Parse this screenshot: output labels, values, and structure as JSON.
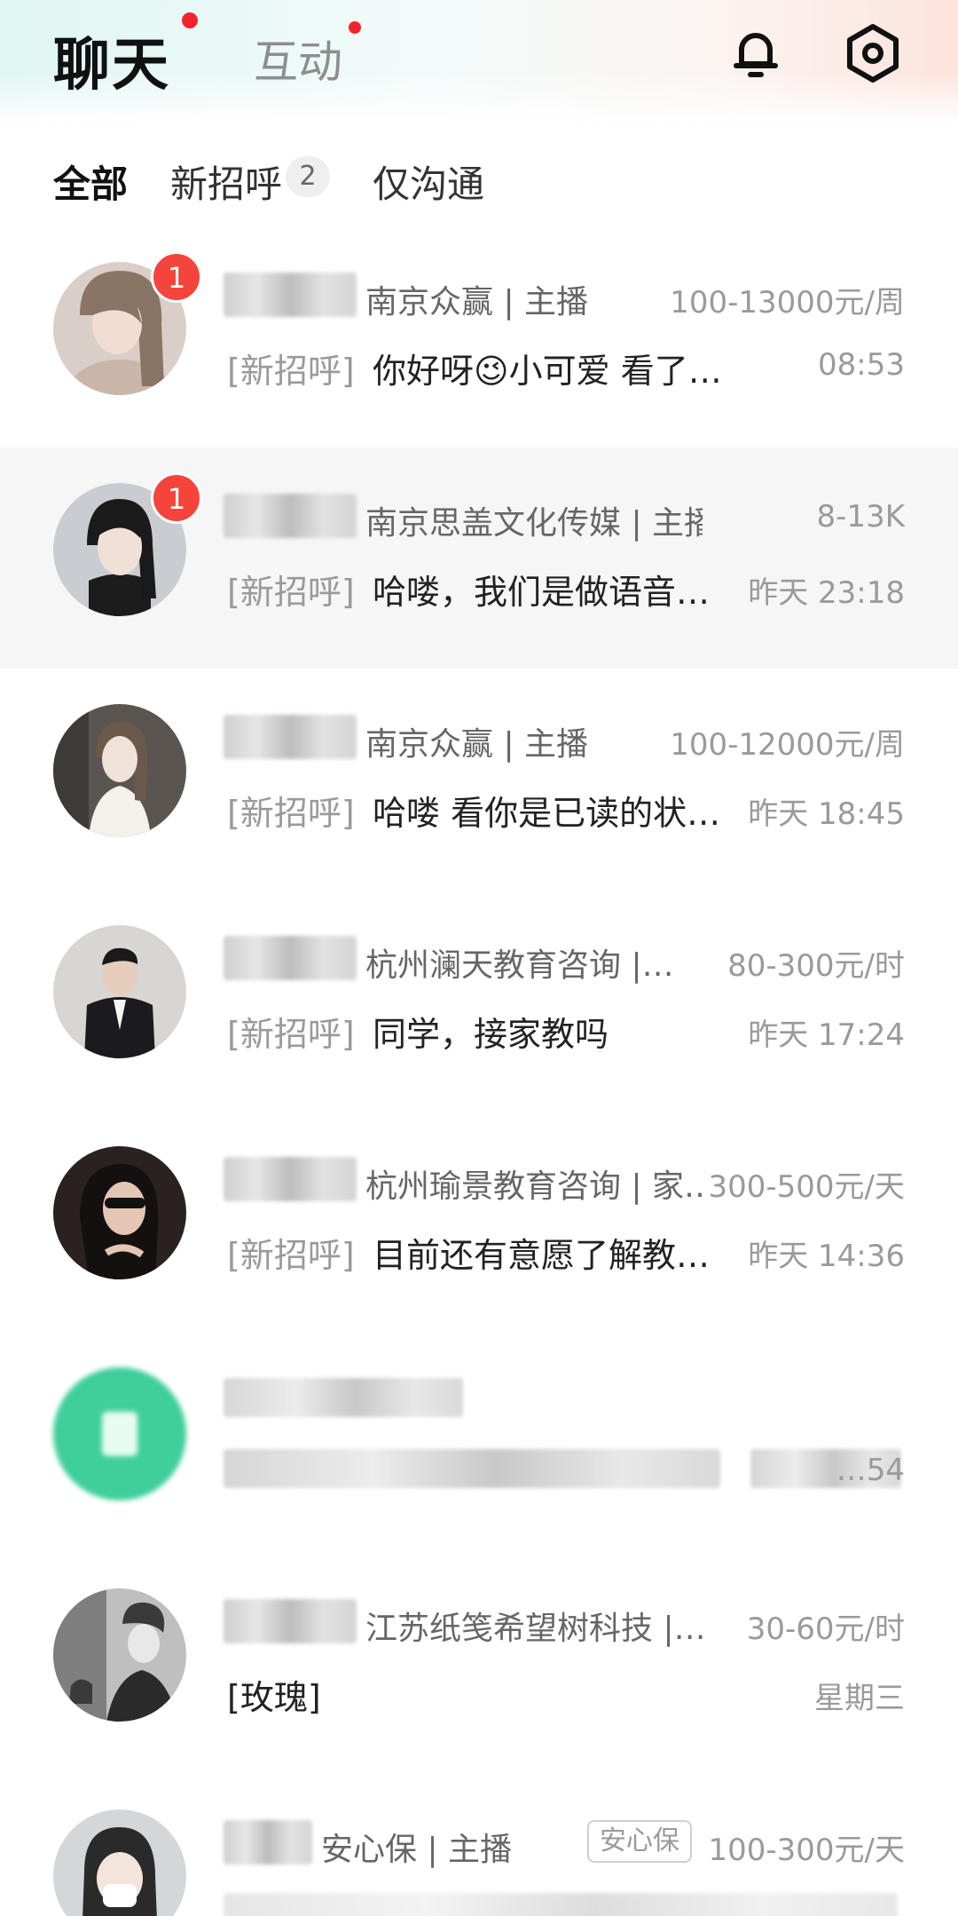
{
  "header": {
    "title": "聊天",
    "alt_tab": "互动",
    "bell_icon": "bell-icon",
    "settings_icon": "gear-icon"
  },
  "tabs": [
    {
      "label": "全部",
      "active": true
    },
    {
      "label": "新招呼",
      "badge": "2"
    },
    {
      "label": "仅沟通"
    }
  ],
  "colors": {
    "accent": "#2fbfae",
    "badge_red": "#f5443b"
  },
  "chats": [
    {
      "company": "南京众赢 | 主播",
      "salary": "100-13000元/周",
      "prefix": "[新招呼]",
      "message": "你好呀😉小可爱 看了你…",
      "time": "08:53",
      "unread": "1"
    },
    {
      "company": "南京思盖文化传媒 | 主播",
      "salary": "8-13K",
      "prefix": "[新招呼]",
      "message": "哈喽，我们是做语音…",
      "time": "昨天 23:18",
      "unread": "1"
    },
    {
      "company": "南京众赢 | 主播",
      "salary": "100-12000元/周",
      "prefix": "[新招呼]",
      "message": "哈喽 看你是已读的状…",
      "time": "昨天 18:45"
    },
    {
      "company": "杭州澜天教育咨询 |…",
      "salary": "80-300元/时",
      "prefix": "[新招呼]",
      "message": "同学，接家教吗",
      "time": "昨天 17:24"
    },
    {
      "company": "杭州瑜景教育咨询 | 家…",
      "salary": "300-500元/天",
      "prefix": "[新招呼]",
      "message": "目前还有意愿了解教…",
      "time": "昨天 14:36"
    },
    {
      "company": "",
      "salary": "",
      "prefix": "",
      "message": "",
      "time": "…54"
    },
    {
      "company": "江苏纸笺希望树科技 |…",
      "salary": "30-60元/时",
      "prefix": "",
      "message": "[玫瑰]",
      "time": "星期三"
    },
    {
      "company": "安心保 | 主播",
      "tag": "安心保",
      "salary": "100-300元/天",
      "prefix": "",
      "message": "",
      "time": ""
    }
  ]
}
